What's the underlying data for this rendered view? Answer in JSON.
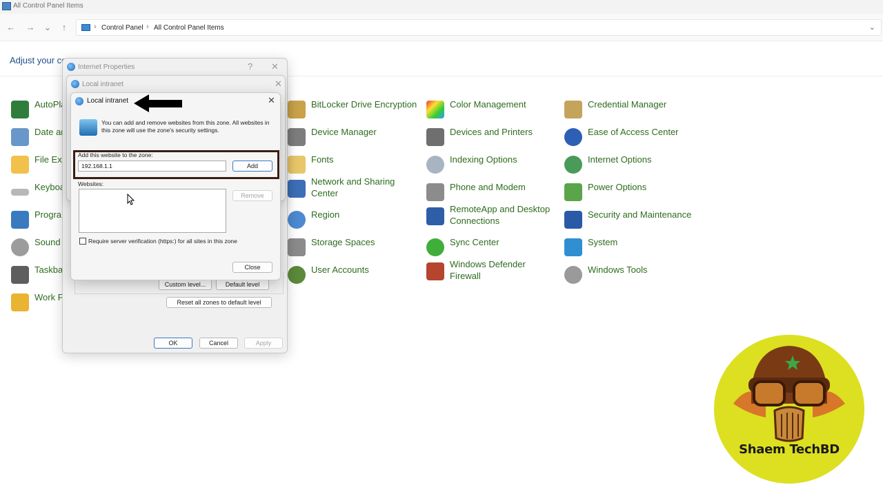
{
  "window": {
    "title": "All Control Panel Items"
  },
  "address": {
    "crumbs": [
      "Control Panel",
      "All Control Panel Items"
    ],
    "separator": "›"
  },
  "nav": {
    "back": "←",
    "forward": "→",
    "recent": "⌄",
    "up": "↑",
    "dropdown": "⌄"
  },
  "header": {
    "adjust_text": "Adjust your co"
  },
  "items": {
    "col1": [
      "AutoPla",
      "Date ar",
      "File Exp",
      "Keyboa",
      "Progra",
      "Sound",
      "Taskbar",
      "Work F"
    ],
    "col2": [
      {
        "label": "BitLocker Drive Encryption",
        "icon": "bitlocker-icon"
      },
      {
        "label": "Device Manager",
        "icon": "device-manager-icon"
      },
      {
        "label": "Fonts",
        "icon": "fonts-icon"
      },
      {
        "label": "Network and Sharing",
        "label2": "Center",
        "icon": "network-icon"
      },
      {
        "label": "Region",
        "icon": "region-icon"
      },
      {
        "label": "Storage Spaces",
        "icon": "storage-icon"
      },
      {
        "label": "User Accounts",
        "icon": "user-accounts-icon"
      }
    ],
    "col3": [
      {
        "label": "Color Management",
        "icon": "color-management-icon"
      },
      {
        "label": "Devices and Printers",
        "icon": "printer-icon"
      },
      {
        "label": "Indexing Options",
        "icon": "indexing-icon"
      },
      {
        "label": "Phone and Modem",
        "icon": "phone-icon"
      },
      {
        "label": "RemoteApp and Desktop",
        "label2": "Connections",
        "icon": "remoteapp-icon"
      },
      {
        "label": "Sync Center",
        "icon": "sync-icon"
      },
      {
        "label": "Windows Defender",
        "label2": "Firewall",
        "icon": "firewall-icon"
      }
    ],
    "col4": [
      {
        "label": "Credential Manager",
        "icon": "credential-icon"
      },
      {
        "label": "Ease of Access Center",
        "icon": "ease-access-icon"
      },
      {
        "label": "Internet Options",
        "icon": "internet-options-icon"
      },
      {
        "label": "Power Options",
        "icon": "power-icon"
      },
      {
        "label": "Security and Maintenance",
        "icon": "security-flag-icon"
      },
      {
        "label": "System",
        "icon": "system-icon"
      },
      {
        "label": "Windows Tools",
        "icon": "tools-icon"
      }
    ]
  },
  "internet_properties": {
    "title": "Internet Properties",
    "help": "?",
    "close": "✕",
    "custom_level": "Custom level...",
    "default_level": "Default level",
    "reset_all": "Reset all zones to default level",
    "ok": "OK",
    "cancel": "Cancel",
    "apply": "Apply"
  },
  "local_intranet_outer": {
    "title": "Local intranet",
    "close": "✕"
  },
  "local_intranet": {
    "title": "Local intranet",
    "close": "✕",
    "info": "You can add and remove websites from this zone. All websites in this zone will use the zone's security settings.",
    "add_label": "Add this website to the zone:",
    "add_value": "192.168.1.1",
    "add_button": "Add",
    "websites_label": "Websites:",
    "remove_button": "Remove",
    "require_https": "Require server verification (https:) for all sites in this zone",
    "close_button": "Close"
  },
  "watermark": {
    "name": "Shaem TechBD"
  },
  "colors": {
    "link_green": "#2e6b1f",
    "highlight_box": "#3a1d12",
    "badge_yellow": "#dce020"
  }
}
